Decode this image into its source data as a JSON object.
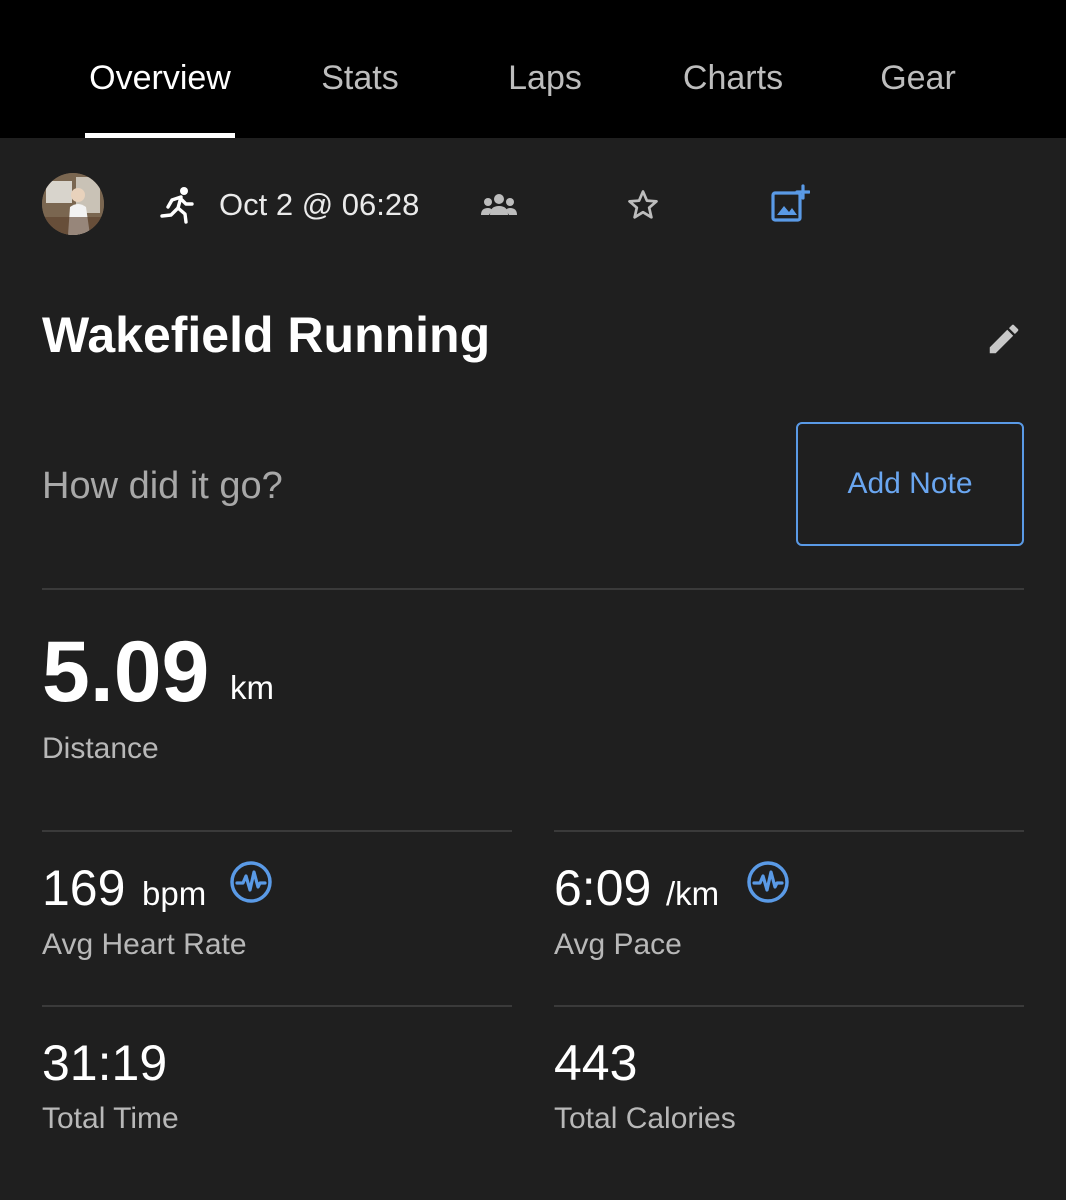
{
  "tabs": [
    {
      "label": "Overview",
      "active": true
    },
    {
      "label": "Stats",
      "active": false
    },
    {
      "label": "Laps",
      "active": false
    },
    {
      "label": "Charts",
      "active": false
    },
    {
      "label": "Gear",
      "active": false
    }
  ],
  "meta": {
    "activity_icon": "running-icon",
    "date": "Oct 2 @ 06:28",
    "icons": [
      "group-icon",
      "star-outline-icon",
      "add-photo-icon"
    ]
  },
  "activity": {
    "title": "Wakefield Running",
    "edit_icon": "pencil-icon",
    "note_prompt": "How did it go?",
    "add_note_label": "Add Note"
  },
  "stats": {
    "distance": {
      "value": "5.09",
      "unit": "km",
      "label": "Distance"
    },
    "heart_rate": {
      "value": "169",
      "unit": "bpm",
      "label": "Avg Heart Rate",
      "icon": "pulse-chart-icon"
    },
    "pace": {
      "value": "6:09",
      "unit": "/km",
      "label": "Avg Pace",
      "icon": "pulse-chart-icon"
    },
    "time": {
      "value": "31:19",
      "label": "Total Time"
    },
    "calories": {
      "value": "443",
      "label": "Total Calories"
    }
  },
  "colors": {
    "background": "#1f1f1f",
    "tabbar": "#000000",
    "accent": "#5a9ae6",
    "divider": "#3a3a3a"
  }
}
